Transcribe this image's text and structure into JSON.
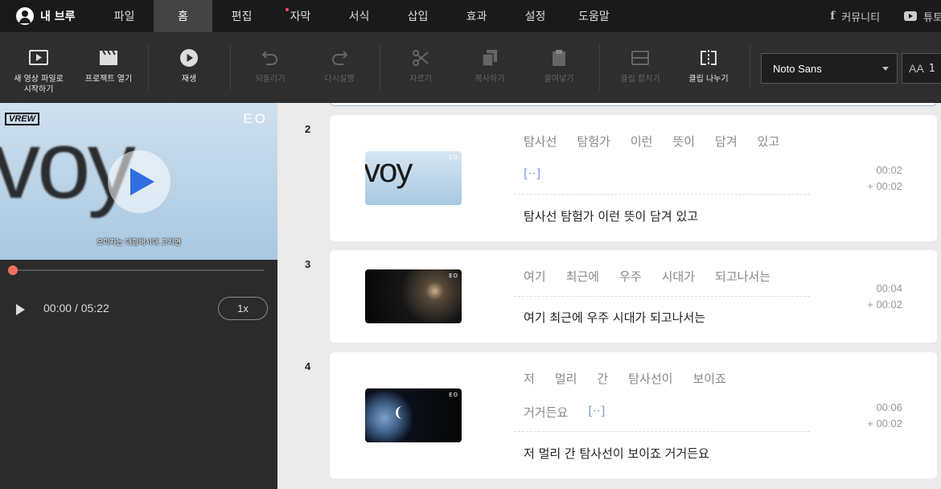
{
  "menubar": {
    "user_name": "내 브루",
    "items": [
      "파일",
      "홈",
      "편집",
      "자막",
      "서식",
      "삽입",
      "효과",
      "설정",
      "도움말"
    ],
    "active_index": 1,
    "community_label": "커뮤니티",
    "tutorial_label": "튜토"
  },
  "toolbar": {
    "new_video_label_1": "새 영상 파일로",
    "new_video_label_2": "시작하기",
    "open_project_label": "프로젝트 열기",
    "play_label": "재생",
    "undo_label": "되돌리기",
    "redo_label": "다시실행",
    "cut_label": "자르기",
    "copy_label": "복사하기",
    "paste_label": "붙여넣기",
    "merge_clip_label": "클립 합치기",
    "split_clip_label": "클립 나누기",
    "font_name": "Noto Sans",
    "font_size": "1"
  },
  "preview": {
    "watermark_text": "voy",
    "vrew_logo": "VREW",
    "eo_logo": "EO",
    "subtitle": "오미자는 대형해시대 고치면",
    "time_display": "00:00 / 05:22",
    "speed": "1x"
  },
  "clips": [
    {
      "number": "2",
      "words": [
        "탐사선",
        "탐험가",
        "이런",
        "뜻이",
        "담겨",
        "있고"
      ],
      "gap_marker": "[··]",
      "sentence": "탐사선 탐험가 이런 뜻이 담겨 있고",
      "duration": "00:02",
      "gap": "+ 00:02",
      "thumb_text": "voy"
    },
    {
      "number": "3",
      "words": [
        "여기",
        "최근에",
        "우주",
        "시대가",
        "되고나서는"
      ],
      "sentence": "여기 최근에 우주 시대가 되고나서는",
      "duration": "00:04",
      "gap": "+ 00:02"
    },
    {
      "number": "4",
      "words": [
        "저",
        "멀리",
        "간",
        "탐사선이",
        "보이죠"
      ],
      "words_line2": [
        "거거든요"
      ],
      "gap_marker": "[··]",
      "sentence": "저 멀리 간 탐사선이 보이죠 거거든요",
      "duration": "00:06",
      "gap": "+ 00:02"
    }
  ]
}
